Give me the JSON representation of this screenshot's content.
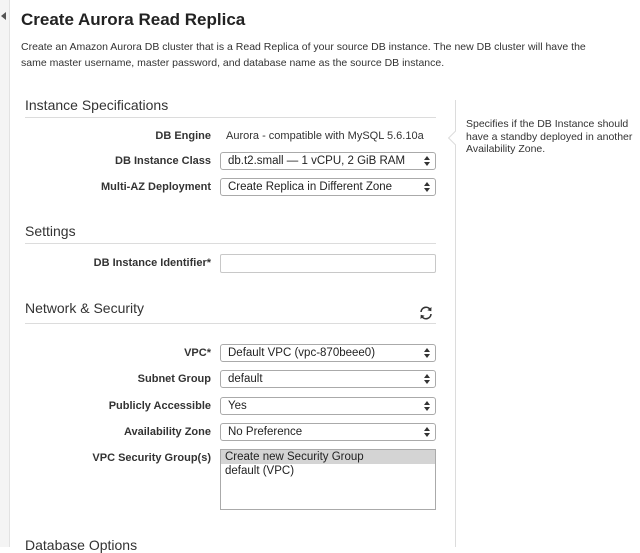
{
  "page": {
    "title": "Create Aurora Read Replica",
    "description": "Create an Amazon Aurora DB cluster that is a Read Replica of your source DB instance. The new DB cluster will have the same master username, master password, and database name as the source DB instance."
  },
  "sections": {
    "instance_specifications": "Instance Specifications",
    "settings": "Settings",
    "network_security": "Network & Security",
    "database_options": "Database Options"
  },
  "instance": {
    "db_engine_label": "DB Engine",
    "db_engine_value": "Aurora - compatible with MySQL 5.6.10a",
    "db_instance_class_label": "DB Instance Class",
    "db_instance_class_value": "db.t2.small — 1 vCPU, 2 GiB RAM",
    "multi_az_label": "Multi-AZ Deployment",
    "multi_az_value": "Create Replica in Different Zone"
  },
  "settings": {
    "identifier_label": "DB Instance Identifier*",
    "identifier_value": ""
  },
  "network": {
    "vpc_label": "VPC*",
    "vpc_value": "Default VPC (vpc-870beee0)",
    "subnet_label": "Subnet Group",
    "subnet_value": "default",
    "public_label": "Publicly Accessible",
    "public_value": "Yes",
    "az_label": "Availability Zone",
    "az_value": "No Preference",
    "sg_label": "VPC Security Group(s)",
    "sg_options": [
      "Create new Security Group",
      "default (VPC)"
    ]
  },
  "help": {
    "text": "Specifies if the DB Instance should have a standby deployed in another Availability Zone."
  },
  "icons": {
    "refresh": "refresh-icon",
    "collapse": "collapse-left-icon",
    "select_arrows": "select-arrows-icon"
  },
  "colors": {
    "text": "#222222",
    "rule": "#dcdcdc",
    "listbox_selected": "#d4d4d4"
  }
}
